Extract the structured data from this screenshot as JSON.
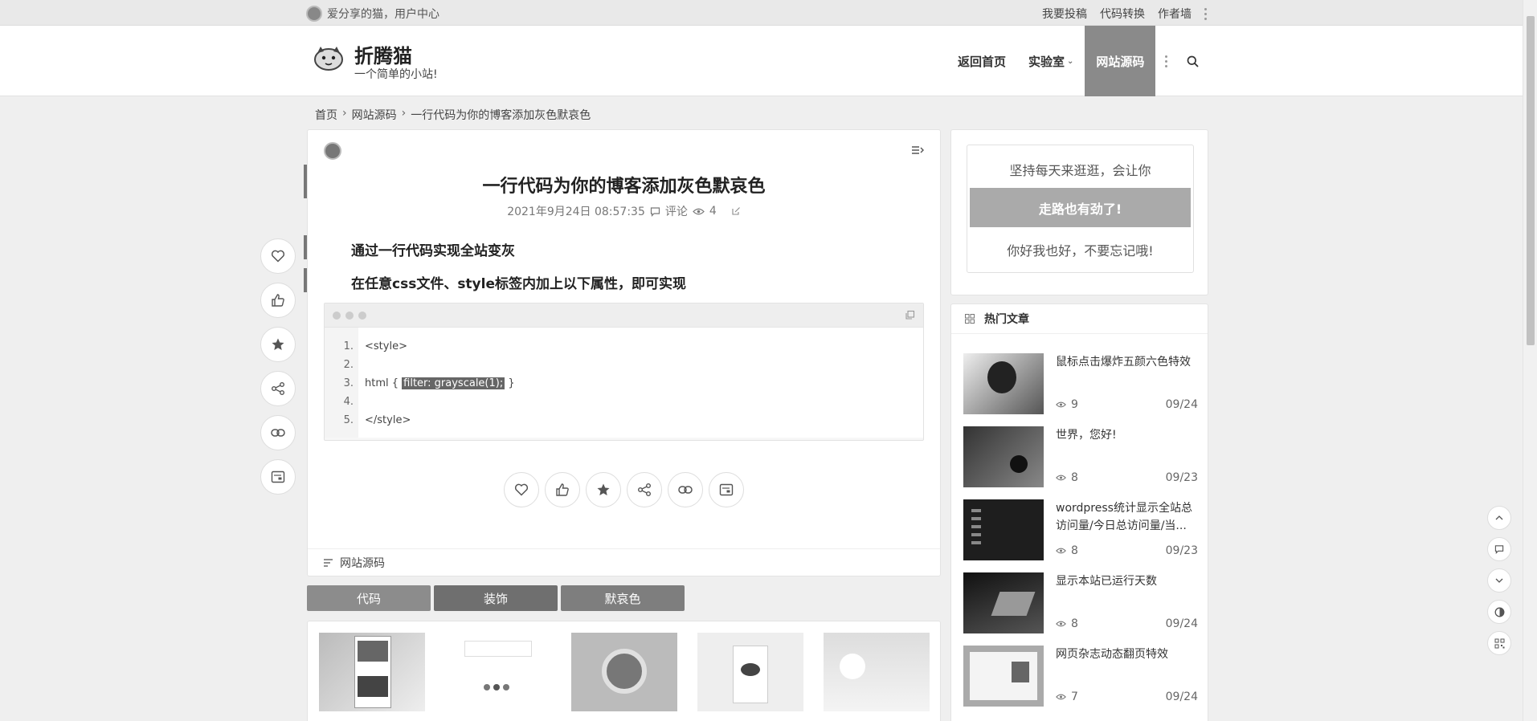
{
  "topbar": {
    "greeting": "爱分享的猫，用户中心",
    "links": [
      "我要投稿",
      "代码转换",
      "作者墙"
    ]
  },
  "header": {
    "site_name": "折腾猫",
    "site_subtitle": "一个简单的小站!",
    "nav": [
      {
        "label": "返回首页"
      },
      {
        "label": "实验室"
      },
      {
        "label": "网站源码"
      }
    ]
  },
  "breadcrumb": [
    "首页",
    "网站源码",
    "一行代码为你的博客添加灰色默哀色"
  ],
  "article": {
    "title": "一行代码为你的博客添加灰色默哀色",
    "datetime": "2021年9月24日 08:57:35",
    "comments_label": "评论",
    "views": "4",
    "paragraph1": "通过一行代码实现全站变灰",
    "paragraph2": "在任意css文件、style标签内加上以下属性，即可实现",
    "code": {
      "line_numbers": [
        "1.",
        "2.",
        "3.",
        "4.",
        "5."
      ],
      "line1": "<style>",
      "line3_prefix": "html { ",
      "line3_highlight": "filter: grayscale(1);",
      "line3_suffix": " }",
      "line5": "</style>"
    },
    "category": "网站源码"
  },
  "tags": [
    "代码",
    "装饰",
    "默哀色"
  ],
  "sidebar": {
    "promo": {
      "line1": "坚持每天来逛逛，会让你",
      "button": "走路也有劲了!",
      "line2": "你好我也好，不要忘记哦!"
    },
    "hot_title": "热门文章",
    "posts": [
      {
        "title": "鼠标点击爆炸五颜六色特效",
        "views": "9",
        "date": "09/24"
      },
      {
        "title": "世界，您好!",
        "views": "8",
        "date": "09/23"
      },
      {
        "title": "wordpress统计显示全站总访问量/今日总访问量/当...",
        "views": "8",
        "date": "09/23"
      },
      {
        "title": "显示本站已运行天数",
        "views": "8",
        "date": "09/24"
      },
      {
        "title": "网页杂志动态翻页特效",
        "views": "7",
        "date": "09/24"
      }
    ]
  },
  "colors": {
    "nav_active": "#8a8a8a",
    "tag1": "#8c8c8c",
    "tag2": "#6f6f6f",
    "tag3": "#7e7e7e",
    "promo_button": "#aaaaaa"
  }
}
